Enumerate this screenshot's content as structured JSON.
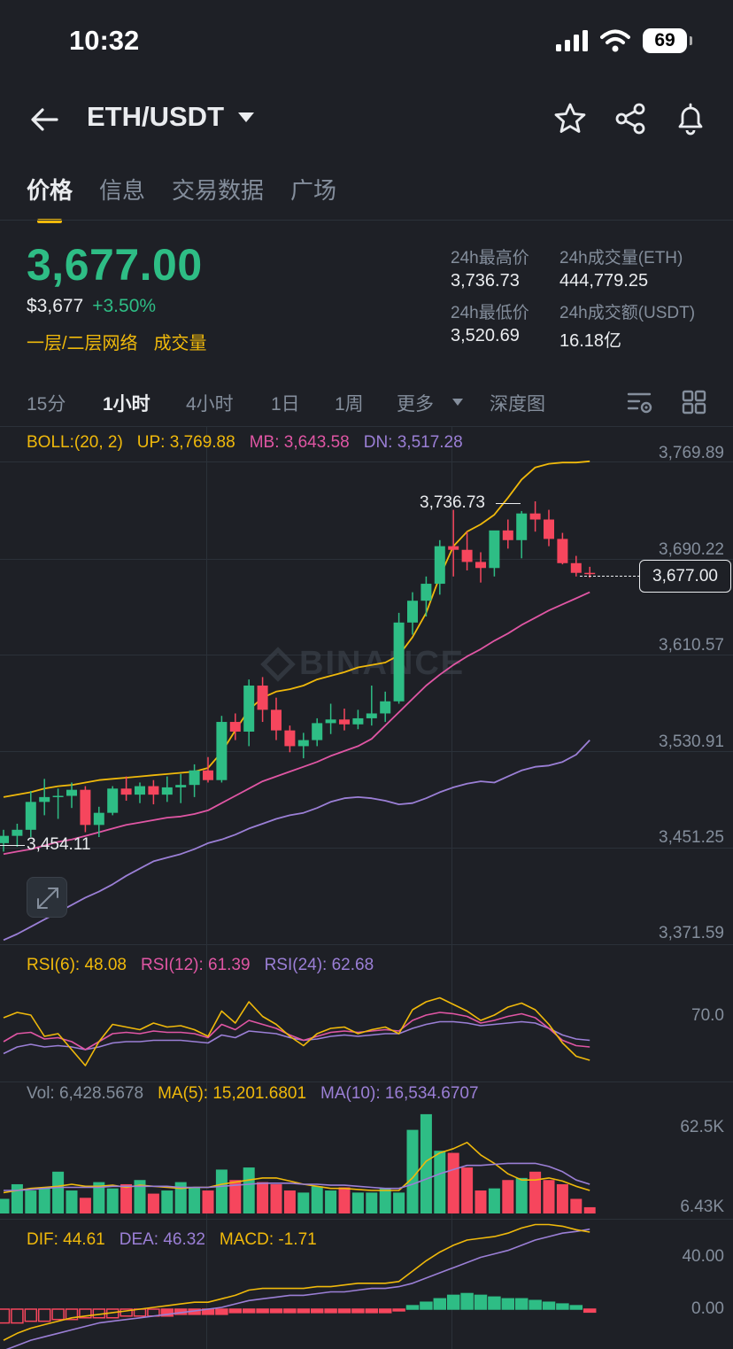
{
  "status_bar": {
    "time": "10:32",
    "battery": "69"
  },
  "header": {
    "pair": "ETH/USDT"
  },
  "tabs": [
    {
      "label": "价格",
      "active": true
    },
    {
      "label": "信息",
      "active": false
    },
    {
      "label": "交易数据",
      "active": false
    },
    {
      "label": "广场",
      "active": false
    }
  ],
  "ticker": {
    "last_price": "3,677.00",
    "usd_price": "$3,677",
    "change": "+3.50%",
    "tags": [
      "一层/二层网络",
      "成交量"
    ],
    "stats": [
      {
        "label": "24h最高价",
        "value": "3,736.73"
      },
      {
        "label": "24h成交量(ETH)",
        "value": "444,779.25"
      },
      {
        "label": "24h最低价",
        "value": "3,520.69"
      },
      {
        "label": "24h成交额(USDT)",
        "value": "16.18亿"
      }
    ]
  },
  "timeframes": [
    {
      "label": "15分",
      "active": false
    },
    {
      "label": "1小时",
      "active": true
    },
    {
      "label": "4小时",
      "active": false
    },
    {
      "label": "1日",
      "active": false
    },
    {
      "label": "1周",
      "active": false
    },
    {
      "label": "更多",
      "active": false
    },
    {
      "label": "深度图",
      "active": false
    }
  ],
  "colors": {
    "up": "#2ebd85",
    "down": "#f6465d",
    "yellow": "#f0b90b",
    "pink": "#e056a4",
    "purple": "#9b7fd6"
  },
  "boll": {
    "label": "BOLL:(20, 2)",
    "up": "UP: 3,769.88",
    "mb": "MB: 3,643.58",
    "dn": "DN: 3,517.28"
  },
  "price_axis": [
    "3,769.89",
    "3,690.22",
    "3,610.57",
    "3,530.91",
    "3,451.25",
    "3,371.59"
  ],
  "annotations": {
    "high": "3,736.73",
    "low": "3,454.11",
    "current": "3,677.00"
  },
  "watermark": "BINANCE",
  "rsi": {
    "rsi6": "RSI(6): 48.08",
    "rsi12": "RSI(12): 61.39",
    "rsi24": "RSI(24): 62.68",
    "axis": "70.0"
  },
  "volume": {
    "vol": "Vol: 6,428.5678",
    "ma5": "MA(5): 15,201.6801",
    "ma10": "MA(10): 16,534.6707",
    "axis": [
      "62.5K",
      "6.43K"
    ]
  },
  "macd": {
    "dif": "DIF: 44.61",
    "dea": "DEA: 46.32",
    "macd": "MACD: -1.71",
    "axis": [
      "40.00",
      "0.00"
    ]
  },
  "chart_data": {
    "type": "candlestick",
    "price_range": [
      3371.59,
      3769.89
    ],
    "candles": [
      {
        "o": 3455,
        "h": 3466,
        "l": 3448,
        "c": 3461
      },
      {
        "o": 3461,
        "h": 3471,
        "l": 3452,
        "c": 3466
      },
      {
        "o": 3466,
        "h": 3498,
        "l": 3460,
        "c": 3489
      },
      {
        "o": 3489,
        "h": 3508,
        "l": 3478,
        "c": 3493
      },
      {
        "o": 3493,
        "h": 3500,
        "l": 3475,
        "c": 3494
      },
      {
        "o": 3494,
        "h": 3505,
        "l": 3484,
        "c": 3499
      },
      {
        "o": 3499,
        "h": 3502,
        "l": 3464,
        "c": 3470
      },
      {
        "o": 3470,
        "h": 3485,
        "l": 3460,
        "c": 3480
      },
      {
        "o": 3480,
        "h": 3502,
        "l": 3478,
        "c": 3500
      },
      {
        "o": 3500,
        "h": 3510,
        "l": 3490,
        "c": 3495
      },
      {
        "o": 3495,
        "h": 3505,
        "l": 3488,
        "c": 3502
      },
      {
        "o": 3502,
        "h": 3507,
        "l": 3487,
        "c": 3495
      },
      {
        "o": 3495,
        "h": 3510,
        "l": 3489,
        "c": 3501
      },
      {
        "o": 3501,
        "h": 3512,
        "l": 3488,
        "c": 3503
      },
      {
        "o": 3503,
        "h": 3520,
        "l": 3493,
        "c": 3515
      },
      {
        "o": 3515,
        "h": 3526,
        "l": 3505,
        "c": 3507
      },
      {
        "o": 3507,
        "h": 3560,
        "l": 3505,
        "c": 3555
      },
      {
        "o": 3555,
        "h": 3562,
        "l": 3540,
        "c": 3547
      },
      {
        "o": 3547,
        "h": 3590,
        "l": 3535,
        "c": 3585
      },
      {
        "o": 3585,
        "h": 3592,
        "l": 3555,
        "c": 3565
      },
      {
        "o": 3565,
        "h": 3575,
        "l": 3540,
        "c": 3548
      },
      {
        "o": 3548,
        "h": 3552,
        "l": 3530,
        "c": 3535
      },
      {
        "o": 3535,
        "h": 3546,
        "l": 3525,
        "c": 3540
      },
      {
        "o": 3540,
        "h": 3558,
        "l": 3535,
        "c": 3554
      },
      {
        "o": 3554,
        "h": 3570,
        "l": 3545,
        "c": 3557
      },
      {
        "o": 3557,
        "h": 3566,
        "l": 3548,
        "c": 3553
      },
      {
        "o": 3553,
        "h": 3565,
        "l": 3549,
        "c": 3558
      },
      {
        "o": 3558,
        "h": 3585,
        "l": 3552,
        "c": 3562
      },
      {
        "o": 3562,
        "h": 3580,
        "l": 3555,
        "c": 3572
      },
      {
        "o": 3572,
        "h": 3645,
        "l": 3570,
        "c": 3637
      },
      {
        "o": 3637,
        "h": 3662,
        "l": 3627,
        "c": 3655
      },
      {
        "o": 3655,
        "h": 3675,
        "l": 3642,
        "c": 3669
      },
      {
        "o": 3669,
        "h": 3705,
        "l": 3660,
        "c": 3700
      },
      {
        "o": 3700,
        "h": 3730,
        "l": 3675,
        "c": 3697
      },
      {
        "o": 3697,
        "h": 3712,
        "l": 3680,
        "c": 3687
      },
      {
        "o": 3687,
        "h": 3695,
        "l": 3670,
        "c": 3682
      },
      {
        "o": 3682,
        "h": 3705,
        "l": 3675,
        "c": 3713
      },
      {
        "o": 3713,
        "h": 3722,
        "l": 3698,
        "c": 3705
      },
      {
        "o": 3705,
        "h": 3729,
        "l": 3690,
        "c": 3727
      },
      {
        "o": 3727,
        "h": 3737,
        "l": 3712,
        "c": 3722
      },
      {
        "o": 3722,
        "h": 3730,
        "l": 3700,
        "c": 3706
      },
      {
        "o": 3706,
        "h": 3711,
        "l": 3685,
        "c": 3686
      },
      {
        "o": 3686,
        "h": 3692,
        "l": 3675,
        "c": 3678
      },
      {
        "o": 3678,
        "h": 3683,
        "l": 3674,
        "c": 3677
      }
    ],
    "boll_up": [
      3493,
      3495,
      3497,
      3500,
      3502,
      3503,
      3505,
      3507,
      3508,
      3509,
      3510,
      3511,
      3512,
      3513,
      3514,
      3517,
      3530,
      3548,
      3565,
      3575,
      3580,
      3582,
      3585,
      3590,
      3593,
      3596,
      3600,
      3602,
      3604,
      3610,
      3625,
      3645,
      3675,
      3700,
      3712,
      3718,
      3726,
      3740,
      3755,
      3765,
      3768,
      3769,
      3769,
      3770
    ],
    "boll_mb": [
      3446,
      3448,
      3450,
      3453,
      3456,
      3458,
      3461,
      3464,
      3467,
      3470,
      3472,
      3474,
      3476,
      3477,
      3479,
      3482,
      3488,
      3494,
      3500,
      3506,
      3510,
      3514,
      3518,
      3522,
      3527,
      3531,
      3535,
      3541,
      3552,
      3563,
      3574,
      3585,
      3594,
      3602,
      3609,
      3615,
      3622,
      3628,
      3635,
      3641,
      3647,
      3652,
      3657,
      3662
    ],
    "boll_dn": [
      3375,
      3380,
      3386,
      3392,
      3398,
      3404,
      3410,
      3415,
      3421,
      3428,
      3434,
      3440,
      3443,
      3446,
      3450,
      3455,
      3458,
      3462,
      3467,
      3471,
      3475,
      3478,
      3480,
      3484,
      3489,
      3492,
      3493,
      3492,
      3490,
      3487,
      3488,
      3492,
      3497,
      3501,
      3504,
      3506,
      3505,
      3510,
      3515,
      3518,
      3519,
      3522,
      3528,
      3540
    ],
    "rsi6": [
      62,
      66,
      64,
      48,
      50,
      38,
      26,
      44,
      57,
      55,
      53,
      58,
      55,
      56,
      53,
      48,
      67,
      58,
      74,
      63,
      57,
      48,
      41,
      50,
      54,
      55,
      50,
      53,
      55,
      50,
      68,
      74,
      77,
      72,
      67,
      60,
      64,
      70,
      73,
      68,
      57,
      43,
      33,
      30
    ],
    "rsi12": [
      44,
      50,
      51,
      46,
      47,
      44,
      38,
      44,
      50,
      51,
      50,
      52,
      51,
      51,
      50,
      47,
      57,
      53,
      60,
      57,
      54,
      49,
      45,
      48,
      51,
      52,
      51,
      52,
      53,
      52,
      60,
      64,
      66,
      65,
      63,
      58,
      60,
      63,
      65,
      62,
      54,
      45,
      41,
      40
    ],
    "rsi24": [
      35,
      40,
      42,
      40,
      41,
      40,
      38,
      40,
      43,
      44,
      44,
      45,
      45,
      45,
      44,
      43,
      49,
      47,
      52,
      51,
      50,
      47,
      45,
      46,
      48,
      49,
      48,
      49,
      50,
      50,
      54,
      57,
      59,
      59,
      58,
      56,
      57,
      58,
      59,
      58,
      54,
      49,
      46,
      45
    ],
    "volume": [
      14,
      28,
      22,
      25,
      40,
      22,
      15,
      30,
      24,
      28,
      32,
      19,
      22,
      30,
      25,
      22,
      42,
      32,
      44,
      30,
      28,
      22,
      20,
      26,
      22,
      25,
      20,
      20,
      24,
      20,
      80,
      95,
      60,
      58,
      44,
      22,
      24,
      32,
      34,
      40,
      32,
      28,
      14,
      6
    ],
    "vol_ma5": [
      20,
      22,
      24,
      25,
      26,
      28,
      26,
      26,
      27,
      25,
      27,
      26,
      25,
      24,
      25,
      25,
      28,
      30,
      32,
      34,
      34,
      31,
      28,
      26,
      24,
      24,
      23,
      22,
      22,
      22,
      34,
      50,
      58,
      62,
      68,
      56,
      48,
      38,
      32,
      32,
      34,
      31,
      26,
      22
    ],
    "vol_ma10": [
      22,
      22,
      23,
      24,
      25,
      25,
      25,
      25,
      26,
      26,
      26,
      26,
      26,
      25,
      25,
      25,
      26,
      27,
      28,
      29,
      29,
      29,
      28,
      28,
      27,
      27,
      26,
      25,
      24,
      24,
      28,
      33,
      38,
      42,
      46,
      46,
      47,
      48,
      48,
      48,
      45,
      40,
      32,
      28
    ],
    "macd_hist": [
      -8,
      -8,
      -7,
      -7,
      -6,
      -6,
      -5,
      -5,
      -5,
      -4,
      -4,
      -4,
      -4,
      -3,
      -3,
      -3,
      -3,
      -2,
      -2,
      -2,
      -2,
      -2,
      -2,
      -2,
      -2,
      -2,
      -2,
      -2,
      -2,
      -1,
      2,
      4,
      6,
      8,
      9,
      8,
      7,
      6,
      6,
      5,
      4,
      3,
      2,
      -1.71
    ],
    "macd_dif": [
      -18,
      -14,
      -11,
      -9,
      -7,
      -5,
      -4,
      -3,
      -2,
      -1,
      0,
      1,
      2,
      3,
      4,
      4,
      6,
      8,
      11,
      12,
      12,
      12,
      12,
      13,
      13,
      14,
      15,
      15,
      15,
      16,
      22,
      28,
      33,
      37,
      40,
      41,
      42,
      44,
      47,
      49,
      49,
      48,
      46,
      44.61
    ],
    "macd_dea": [
      -24,
      -21,
      -18,
      -16,
      -14,
      -12,
      -10,
      -8,
      -7,
      -6,
      -5,
      -4,
      -3,
      -2,
      -1,
      0,
      1,
      3,
      5,
      6,
      7,
      8,
      8,
      9,
      10,
      10,
      11,
      12,
      12,
      13,
      15,
      18,
      21,
      24,
      27,
      30,
      32,
      34,
      37,
      40,
      42,
      44,
      45,
      46.32
    ]
  }
}
